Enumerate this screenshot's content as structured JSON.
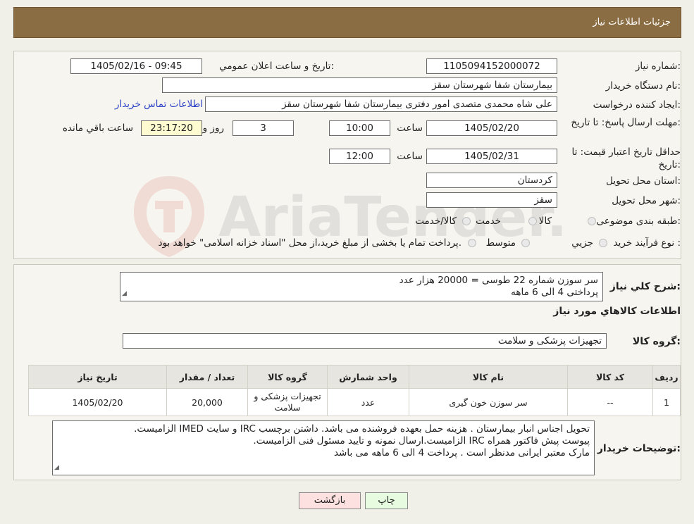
{
  "header": {
    "title": "جزئیات اطلاعات نیاز"
  },
  "form": {
    "need_number_label": "شماره نیاز:",
    "need_number": "1105094152000072",
    "announce_label": "تاریخ و ساعت اعلان عمومي:",
    "announce_value": "1405/02/16 - 09:45",
    "buyer_label": "نام دستگاه خریدار:",
    "buyer": "بیمارستان شفا شهرستان سقز",
    "creator_label": "ایجاد کننده درخواست:",
    "creator": "علی شاه محمدی متصدی امور دفتری بیمارستان شفا شهرستان سقز",
    "contact_link": "اطلاعات تماس خریدار",
    "deadline_label": "مهلت ارسال پاسخ: تا تاریخ:",
    "deadline_date": "1405/02/20",
    "time_label": "ساعت",
    "deadline_time": "10:00",
    "days": "3",
    "days_label": "روز و",
    "remaining": "23:17:20",
    "remaining_label": "ساعت باقي مانده",
    "validity_label": "حداقل تاریخ اعتبار قیمت: تا تاریخ:",
    "validity_date": "1405/02/31",
    "validity_time": "12:00",
    "province_label": "استان محل تحویل:",
    "province": "کردستان",
    "city_label": "شهر محل تحویل:",
    "city": "سقز",
    "category_label": "طبقه بندی موضوعی:",
    "category_options": [
      "کالا",
      "خدمت",
      "کالا/خدمت"
    ],
    "process_label": "نوع فرآیند خرید :",
    "process_options": [
      "جزیي",
      "متوسط"
    ],
    "process_note": "پرداخت تمام یا بخشی از مبلغ خرید،از محل \"اسناد خزانه اسلامی\" خواهد بود."
  },
  "summary": {
    "label": "شرح کلي نیاز:",
    "line1": "سر سوزن شماره 22 طوسی = 20000 هزار عدد",
    "line2": "پرداختی 4 الی 6 ماهه"
  },
  "goods_info_title": "اطلاعات کالاهاي مورد نیاز",
  "goods_group": {
    "label": "گروه کالا:",
    "value": "تجهیزات پزشکی و سلامت"
  },
  "table": {
    "headers": [
      "ردیف",
      "کد کالا",
      "نام کالا",
      "واحد شمارش",
      "گروه کالا",
      "تعداد / مقدار",
      "تاریخ نیاز"
    ],
    "row": {
      "index": "1",
      "code": "--",
      "name": "سر سوزن خون گیری",
      "unit": "عدد",
      "group": "تجهیزات پزشکی و سلامت",
      "qty": "20,000",
      "date": "1405/02/20"
    }
  },
  "buyer_notes": {
    "label": "توضیحات خریدار:",
    "line1": "تحویل اجناس  انبار بیمارستان . هزینه حمل بعهده فروشنده می باشد.  داشتن برچسب IRC  و سایت  IMED  الزامیست.",
    "line2": "پیوست پیش فاکتور همراه IRC  الزامیست.ارسال نمونه و تایید مسئول فنی الزامیست.",
    "line3": "مارک معتبر ایرانی مدنظر است . پرداخت 4 الی 6 ماهه می باشد"
  },
  "buttons": {
    "print": "چاپ",
    "back": "بازگشت"
  },
  "watermark": {
    "text": "AriaTender.neT",
    "color": "#c9352e"
  }
}
